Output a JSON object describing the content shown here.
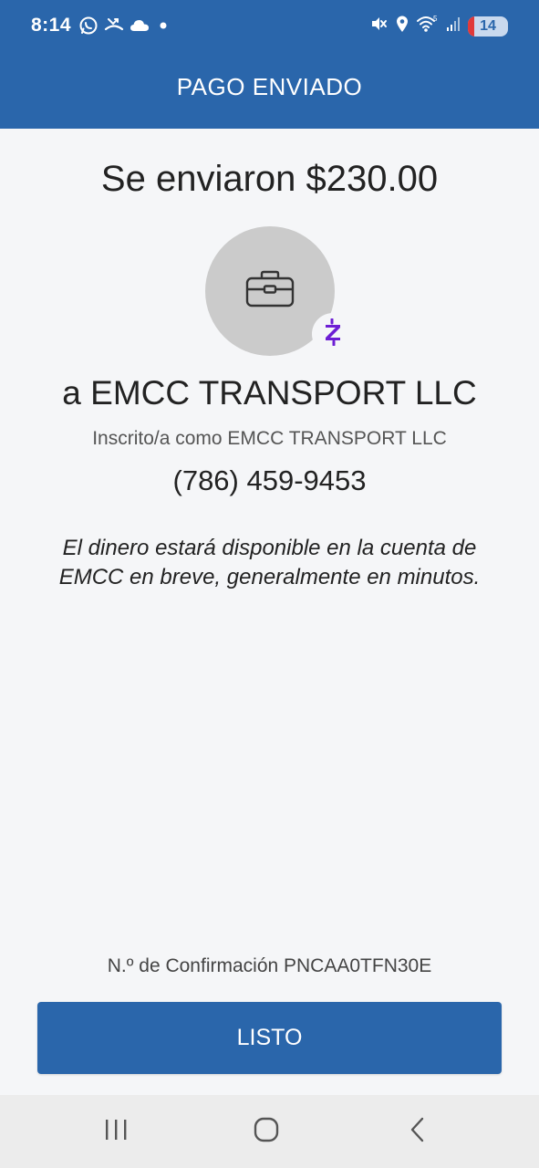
{
  "status_bar": {
    "time": "8:14",
    "battery_level": "14",
    "icons": [
      "whatsapp-icon",
      "missed-call-icon",
      "cloud-icon",
      "notification-dot-icon",
      "mute-icon",
      "location-icon",
      "wifi-icon",
      "signal-icon",
      "battery-icon"
    ]
  },
  "header": {
    "title": "PAGO ENVIADO"
  },
  "payment": {
    "amount_text": "Se enviaron $230.00",
    "recipient_text": "a EMCC TRANSPORT LLC",
    "enrolled_text": "Inscrito/a como EMCC TRANSPORT LLC",
    "phone": "(786) 459-9453",
    "availability_note": "El dinero estará disponible en la cuenta de EMCC en breve, generalmente en minutos.",
    "avatar_icon": "briefcase-icon",
    "badge_icon": "zelle-logo-icon"
  },
  "footer": {
    "confirmation_text": "N.º de Confirmación PNCAA0TFN30E",
    "done_label": "LISTO"
  },
  "nav_bar": {
    "buttons": [
      "recent-apps-icon",
      "home-icon",
      "back-icon"
    ]
  },
  "colors": {
    "brand_blue": "#2a66ab",
    "zelle_purple": "#6d1ed4",
    "background": "#f5f6f8"
  }
}
